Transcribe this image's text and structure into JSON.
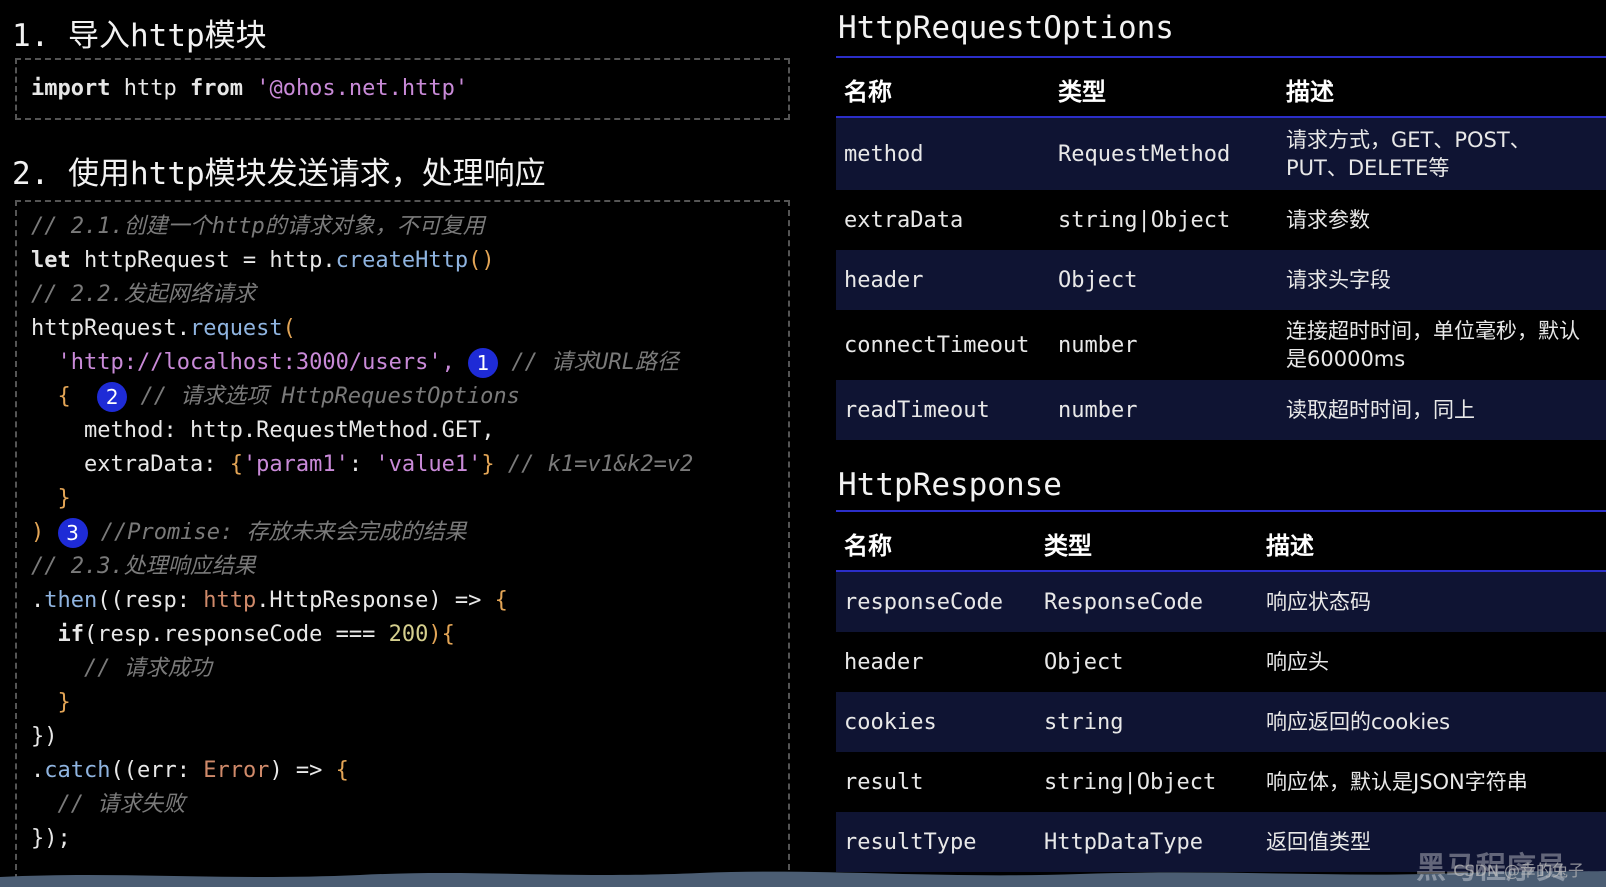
{
  "left": {
    "heading1": "1. 导入http模块",
    "import_line": {
      "kw1": "import",
      "mid": " http ",
      "kw2": "from",
      "str": "'@ohos.net.http'"
    },
    "heading2": "2. 使用http模块发送请求，处理响应",
    "code": {
      "c1": "// 2.1.创建一个http的请求对象，不可复用",
      "l2_kw": "let",
      "l2_mid": " httpRequest = http.",
      "l2_fn": "createHttp",
      "l2_br": "()",
      "c3": "// 2.2.发起网络请求",
      "l4_a": "httpRequest.",
      "l4_fn": "request",
      "l4_br": "(",
      "l5_str": "'http://localhost:3000/users',",
      "l5_badge": "1",
      "l5_cm": "// 请求URL路径",
      "l6_br": "{",
      "l6_badge": "2",
      "l6_cm": "// 请求选项 HttpRequestOptions",
      "l7": "method: http.RequestMethod.GET,",
      "l8_a": "extraData: ",
      "l8_b1": "{",
      "l8_s1": "'param1'",
      "l8_c": ": ",
      "l8_s2": "'value1'",
      "l8_b2": "}",
      "l8_cm": " // k1=v1&k2=v2",
      "l9_br": "}",
      "l10_br": ")",
      "l10_badge": "3",
      "l10_cm": "//Promise: 存放未来会完成的结果",
      "c11": "// 2.3.处理响应结果",
      "l12_a": ".",
      "l12_fn": "then",
      "l12_b": "((resp: ",
      "l12_ty": "http",
      "l12_c": ".HttpResponse",
      "l12_d": ") => ",
      "l12_br": "{",
      "l13_kw": "if",
      "l13_a": "(resp.responseCode === ",
      "l13_num": "200",
      "l13_b": "){",
      "c14": "// 请求成功",
      "l15_br": "}",
      "l16": "})",
      "l17_a": ".",
      "l17_fn": "catch",
      "l17_b": "((err: ",
      "l17_ty": "Error",
      "l17_c": ") => ",
      "l17_br": "{",
      "c18": "// 请求失败",
      "l19": "});"
    }
  },
  "right": {
    "options_title": "HttpRequestOptions",
    "options_headers": [
      "名称",
      "类型",
      "描述"
    ],
    "options_rows": [
      {
        "name": "method",
        "type": "RequestMethod",
        "desc": "请求方式，GET、POST、PUT、DELETE等"
      },
      {
        "name": "extraData",
        "type": "string|Object",
        "desc": "请求参数"
      },
      {
        "name": "header",
        "type": "Object",
        "desc": "请求头字段"
      },
      {
        "name": "connectTimeout",
        "type": "number",
        "desc": "连接超时时间，单位毫秒，默认是60000ms"
      },
      {
        "name": "readTimeout",
        "type": "number",
        "desc": "读取超时时间，同上"
      }
    ],
    "response_title": "HttpResponse",
    "response_headers": [
      "名称",
      "类型",
      "描述"
    ],
    "response_rows": [
      {
        "name": "responseCode",
        "type": "ResponseCode",
        "desc": "响应状态码"
      },
      {
        "name": "header",
        "type": "Object",
        "desc": "响应头"
      },
      {
        "name": "cookies",
        "type": "string",
        "desc": "响应返回的cookies"
      },
      {
        "name": "result",
        "type": "string|Object",
        "desc": "响应体，默认是JSON字符串"
      },
      {
        "name": "resultType",
        "type": "HttpDataType",
        "desc": "返回值类型"
      }
    ]
  },
  "watermark": {
    "csdn": "CSDN @幸的兔子",
    "brand": "黑马程序员"
  }
}
